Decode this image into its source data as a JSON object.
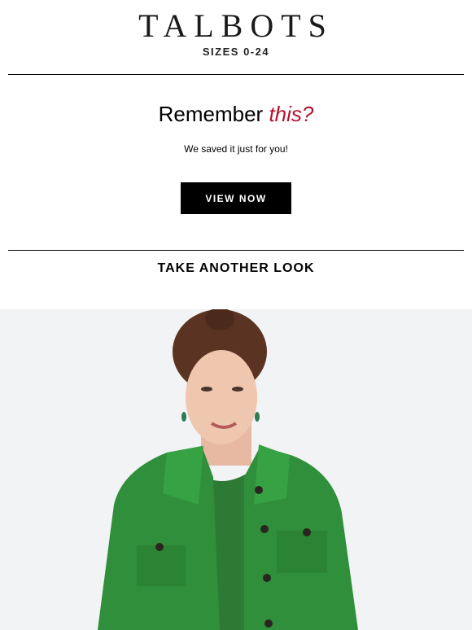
{
  "header": {
    "logo_text": "TALBOTS",
    "sizes_text": "SIZES 0-24"
  },
  "message": {
    "headline_plain": "Remember ",
    "headline_accent": "this?",
    "subtext": "We saved it just for you!",
    "cta_label": "VIEW NOW"
  },
  "section": {
    "title": "TAKE ANOTHER LOOK"
  },
  "colors": {
    "accent": "#b5122b",
    "button_bg": "#000000",
    "jacket_green": "#2f8f3a"
  }
}
